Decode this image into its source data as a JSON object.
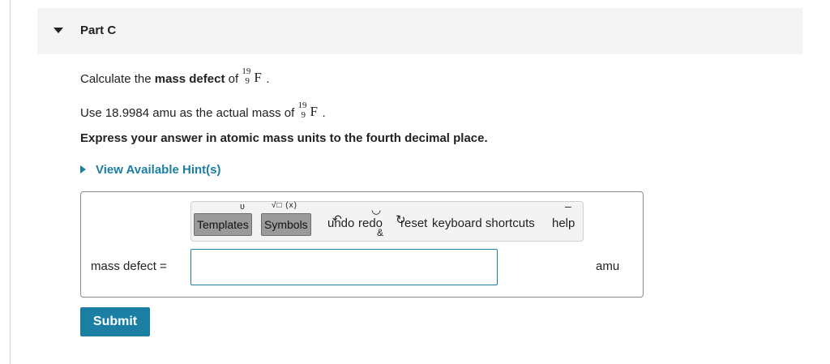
{
  "part": {
    "title": "Part C"
  },
  "question": {
    "line1_prefix": "Calculate the ",
    "line1_bold": "mass defect",
    "line1_suffix": " of ",
    "line1_end": ".",
    "line2_prefix": "Use 18.9984 amu as the actual mass of ",
    "line2_end": ".",
    "instruction": "Express your answer in atomic mass units to the fourth decimal place."
  },
  "nuclide": {
    "mass_number": "19",
    "atomic_number": "9",
    "symbol": "F"
  },
  "hint": {
    "label": "View Available Hint(s)"
  },
  "toolbar": {
    "templates_label": "Templates",
    "symbols_label": "Symbols",
    "undo_label": "undo",
    "redo_label": "redo",
    "reset_label": "reset",
    "shortcuts_label": "keyboard shortcuts",
    "help_label": "help"
  },
  "answer": {
    "label": "mass defect =",
    "value": "",
    "unit": "amu"
  },
  "submit": {
    "label": "Submit"
  },
  "colors": {
    "accent": "#1a7fa3",
    "header_bg": "#f4f4f4",
    "toolbar_button": "#9a9a9a"
  }
}
